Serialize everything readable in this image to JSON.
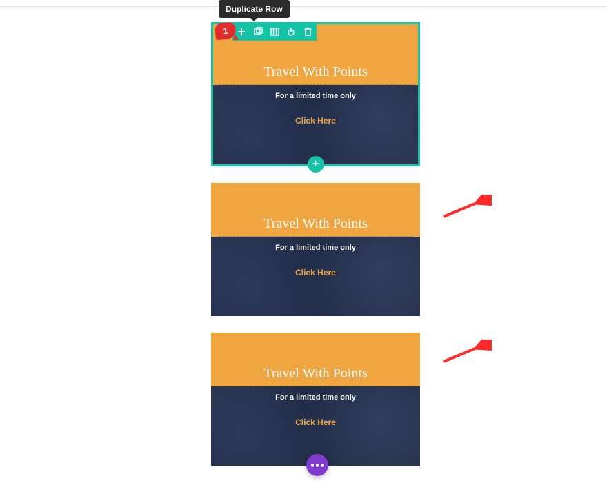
{
  "tooltip": {
    "label": "Duplicate Row"
  },
  "annotation": {
    "badge": "1"
  },
  "toolbar": {
    "icons": [
      "drag",
      "duplicate",
      "columns",
      "settings",
      "delete"
    ]
  },
  "rows": [
    {
      "heading": "Travel With Points",
      "subtext": "For a limited time only",
      "cta": "Click Here",
      "selected": true
    },
    {
      "heading": "Travel With Points",
      "subtext": "For a limited time only",
      "cta": "Click Here",
      "selected": false
    },
    {
      "heading": "Travel With Points",
      "subtext": "For a limited time only",
      "cta": "Click Here",
      "selected": false
    }
  ],
  "add_button": {
    "glyph": "+"
  },
  "colors": {
    "accent_teal": "#17c3a6",
    "orange": "#f0a640",
    "badge_red": "#e32c2c",
    "fab_purple": "#7e3bd0",
    "arrow_red": "#ff2a2a"
  }
}
